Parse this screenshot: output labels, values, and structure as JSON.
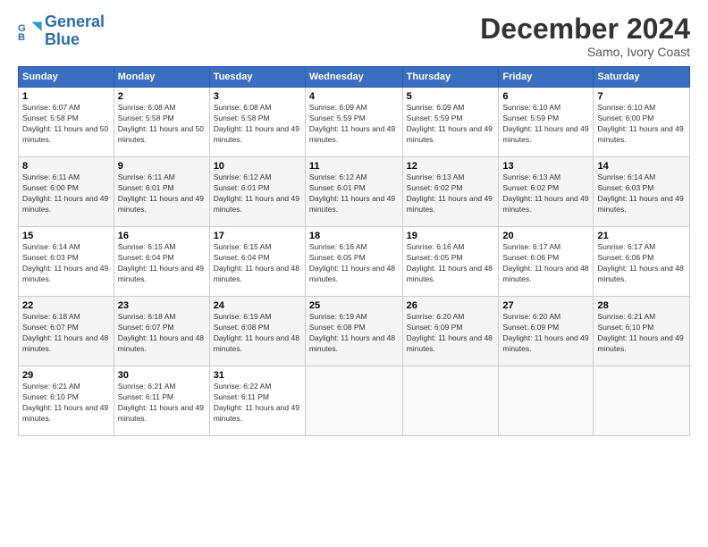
{
  "header": {
    "logo_line1": "General",
    "logo_line2": "Blue",
    "title": "December 2024",
    "subtitle": "Samo, Ivory Coast"
  },
  "days_of_week": [
    "Sunday",
    "Monday",
    "Tuesday",
    "Wednesday",
    "Thursday",
    "Friday",
    "Saturday"
  ],
  "weeks": [
    [
      {
        "num": "1",
        "sunrise": "6:07 AM",
        "sunset": "5:58 PM",
        "daylight": "11 hours and 50 minutes."
      },
      {
        "num": "2",
        "sunrise": "6:08 AM",
        "sunset": "5:58 PM",
        "daylight": "11 hours and 50 minutes."
      },
      {
        "num": "3",
        "sunrise": "6:08 AM",
        "sunset": "5:58 PM",
        "daylight": "11 hours and 49 minutes."
      },
      {
        "num": "4",
        "sunrise": "6:09 AM",
        "sunset": "5:59 PM",
        "daylight": "11 hours and 49 minutes."
      },
      {
        "num": "5",
        "sunrise": "6:09 AM",
        "sunset": "5:59 PM",
        "daylight": "11 hours and 49 minutes."
      },
      {
        "num": "6",
        "sunrise": "6:10 AM",
        "sunset": "5:59 PM",
        "daylight": "11 hours and 49 minutes."
      },
      {
        "num": "7",
        "sunrise": "6:10 AM",
        "sunset": "6:00 PM",
        "daylight": "11 hours and 49 minutes."
      }
    ],
    [
      {
        "num": "8",
        "sunrise": "6:11 AM",
        "sunset": "6:00 PM",
        "daylight": "11 hours and 49 minutes."
      },
      {
        "num": "9",
        "sunrise": "6:11 AM",
        "sunset": "6:01 PM",
        "daylight": "11 hours and 49 minutes."
      },
      {
        "num": "10",
        "sunrise": "6:12 AM",
        "sunset": "6:01 PM",
        "daylight": "11 hours and 49 minutes."
      },
      {
        "num": "11",
        "sunrise": "6:12 AM",
        "sunset": "6:01 PM",
        "daylight": "11 hours and 49 minutes."
      },
      {
        "num": "12",
        "sunrise": "6:13 AM",
        "sunset": "6:02 PM",
        "daylight": "11 hours and 49 minutes."
      },
      {
        "num": "13",
        "sunrise": "6:13 AM",
        "sunset": "6:02 PM",
        "daylight": "11 hours and 49 minutes."
      },
      {
        "num": "14",
        "sunrise": "6:14 AM",
        "sunset": "6:03 PM",
        "daylight": "11 hours and 49 minutes."
      }
    ],
    [
      {
        "num": "15",
        "sunrise": "6:14 AM",
        "sunset": "6:03 PM",
        "daylight": "11 hours and 49 minutes."
      },
      {
        "num": "16",
        "sunrise": "6:15 AM",
        "sunset": "6:04 PM",
        "daylight": "11 hours and 49 minutes."
      },
      {
        "num": "17",
        "sunrise": "6:15 AM",
        "sunset": "6:04 PM",
        "daylight": "11 hours and 48 minutes."
      },
      {
        "num": "18",
        "sunrise": "6:16 AM",
        "sunset": "6:05 PM",
        "daylight": "11 hours and 48 minutes."
      },
      {
        "num": "19",
        "sunrise": "6:16 AM",
        "sunset": "6:05 PM",
        "daylight": "11 hours and 48 minutes."
      },
      {
        "num": "20",
        "sunrise": "6:17 AM",
        "sunset": "6:06 PM",
        "daylight": "11 hours and 48 minutes."
      },
      {
        "num": "21",
        "sunrise": "6:17 AM",
        "sunset": "6:06 PM",
        "daylight": "11 hours and 48 minutes."
      }
    ],
    [
      {
        "num": "22",
        "sunrise": "6:18 AM",
        "sunset": "6:07 PM",
        "daylight": "11 hours and 48 minutes."
      },
      {
        "num": "23",
        "sunrise": "6:18 AM",
        "sunset": "6:07 PM",
        "daylight": "11 hours and 48 minutes."
      },
      {
        "num": "24",
        "sunrise": "6:19 AM",
        "sunset": "6:08 PM",
        "daylight": "11 hours and 48 minutes."
      },
      {
        "num": "25",
        "sunrise": "6:19 AM",
        "sunset": "6:08 PM",
        "daylight": "11 hours and 48 minutes."
      },
      {
        "num": "26",
        "sunrise": "6:20 AM",
        "sunset": "6:09 PM",
        "daylight": "11 hours and 48 minutes."
      },
      {
        "num": "27",
        "sunrise": "6:20 AM",
        "sunset": "6:09 PM",
        "daylight": "11 hours and 49 minutes."
      },
      {
        "num": "28",
        "sunrise": "6:21 AM",
        "sunset": "6:10 PM",
        "daylight": "11 hours and 49 minutes."
      }
    ],
    [
      {
        "num": "29",
        "sunrise": "6:21 AM",
        "sunset": "6:10 PM",
        "daylight": "11 hours and 49 minutes."
      },
      {
        "num": "30",
        "sunrise": "6:21 AM",
        "sunset": "6:11 PM",
        "daylight": "11 hours and 49 minutes."
      },
      {
        "num": "31",
        "sunrise": "6:22 AM",
        "sunset": "6:11 PM",
        "daylight": "11 hours and 49 minutes."
      },
      null,
      null,
      null,
      null
    ]
  ]
}
